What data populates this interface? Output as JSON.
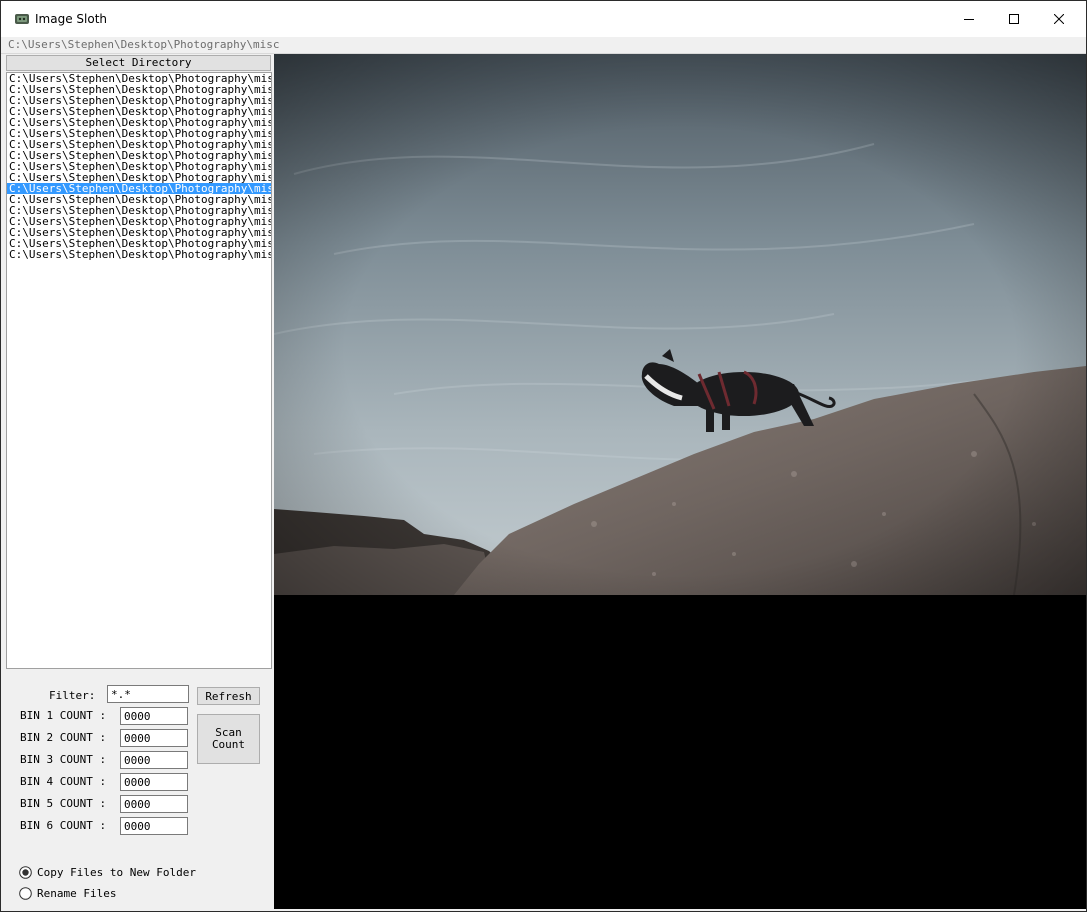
{
  "window": {
    "title": "Image Sloth",
    "current_path": "C:\\Users\\Stephen\\Desktop\\Photography\\misc"
  },
  "left_panel": {
    "select_directory_label": "Select Directory",
    "file_list": {
      "items": [
        "C:\\Users\\Stephen\\Desktop\\Photography\\misc",
        "C:\\Users\\Stephen\\Desktop\\Photography\\misc",
        "C:\\Users\\Stephen\\Desktop\\Photography\\misc",
        "C:\\Users\\Stephen\\Desktop\\Photography\\misc",
        "C:\\Users\\Stephen\\Desktop\\Photography\\misc",
        "C:\\Users\\Stephen\\Desktop\\Photography\\misc",
        "C:\\Users\\Stephen\\Desktop\\Photography\\misc",
        "C:\\Users\\Stephen\\Desktop\\Photography\\misc",
        "C:\\Users\\Stephen\\Desktop\\Photography\\misc",
        "C:\\Users\\Stephen\\Desktop\\Photography\\misc",
        "C:\\Users\\Stephen\\Desktop\\Photography\\misc",
        "C:\\Users\\Stephen\\Desktop\\Photography\\misc",
        "C:\\Users\\Stephen\\Desktop\\Photography\\misc",
        "C:\\Users\\Stephen\\Desktop\\Photography\\misc",
        "C:\\Users\\Stephen\\Desktop\\Photography\\misc",
        "C:\\Users\\Stephen\\Desktop\\Photography\\misc",
        "C:\\Users\\Stephen\\Desktop\\Photography\\misc"
      ],
      "selected_index": 10
    },
    "filter_label": "Filter:",
    "filter_value": "*.*",
    "refresh_label": "Refresh",
    "scan_count_label_line1": "Scan",
    "scan_count_label_line2": "Count",
    "bins": [
      {
        "label": "BIN 1 COUNT :",
        "value": "0000"
      },
      {
        "label": "BIN 2 COUNT :",
        "value": "0000"
      },
      {
        "label": "BIN 3 COUNT :",
        "value": "0000"
      },
      {
        "label": "BIN 4 COUNT :",
        "value": "0000"
      },
      {
        "label": "BIN 5 COUNT :",
        "value": "0000"
      },
      {
        "label": "BIN 6 COUNT :",
        "value": "0000"
      }
    ],
    "mode_options": [
      {
        "label": "Copy Files to New Folder",
        "selected": true
      },
      {
        "label": "Rename Files",
        "selected": false
      }
    ]
  },
  "colors": {
    "selection": "#3399ff",
    "viewer_background": "#000000"
  },
  "icons": {
    "app": "app-icon",
    "minimize": "minimize-icon",
    "maximize": "maximize-icon",
    "close": "close-icon"
  }
}
